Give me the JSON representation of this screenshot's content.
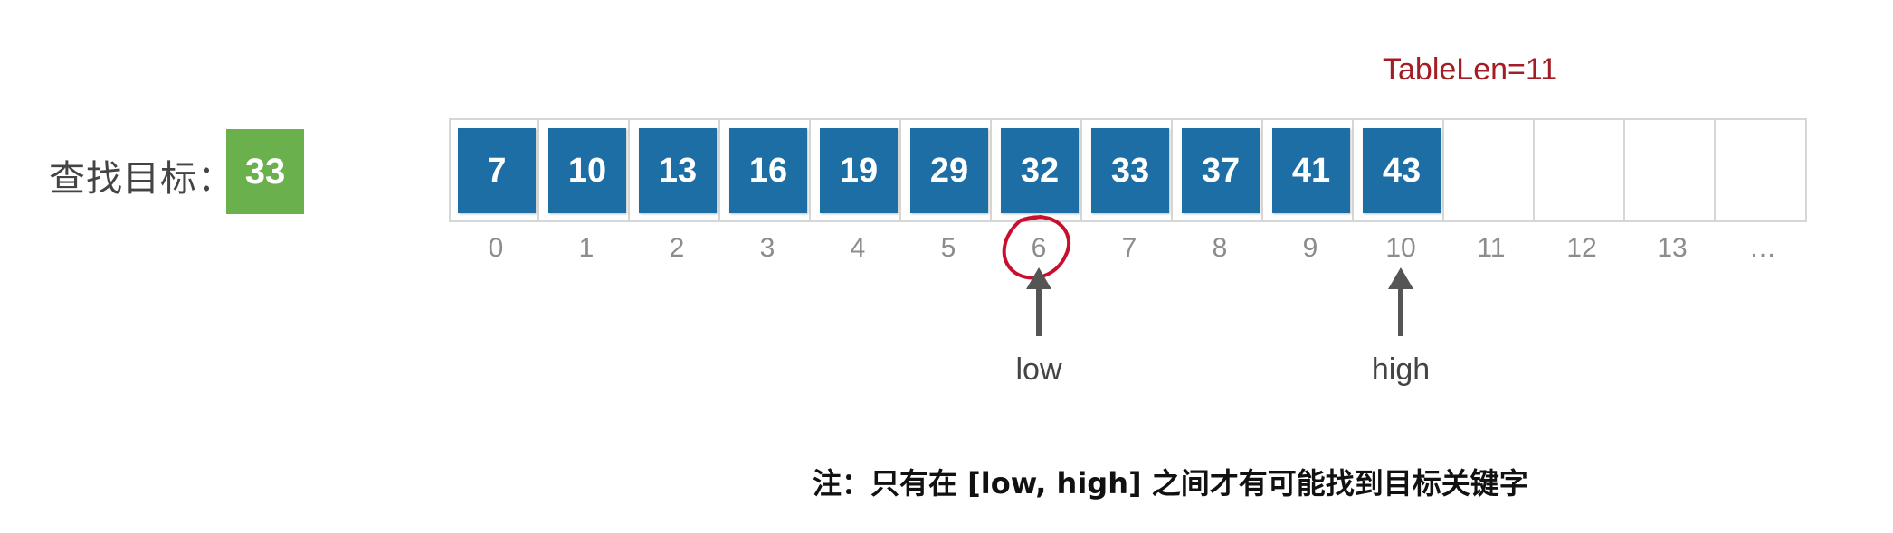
{
  "search_target": {
    "label": "查找目标：",
    "value": "33"
  },
  "table_len_label": "TableLen=11",
  "array": {
    "values": [
      "7",
      "10",
      "13",
      "16",
      "19",
      "29",
      "32",
      "33",
      "37",
      "41",
      "43"
    ],
    "indices": [
      "0",
      "1",
      "2",
      "3",
      "4",
      "5",
      "6",
      "7",
      "8",
      "9",
      "10",
      "11",
      "12",
      "13",
      "…"
    ],
    "cell_color": "#1d6ea5",
    "target_color": "#6ab04c"
  },
  "pointers": [
    {
      "label": "low",
      "index": 6
    },
    {
      "label": "high",
      "index": 10
    }
  ],
  "highlight": {
    "index": 6,
    "color": "#c8102e"
  },
  "note": "注：只有在 [low, high] 之间才有可能找到目标关键字"
}
